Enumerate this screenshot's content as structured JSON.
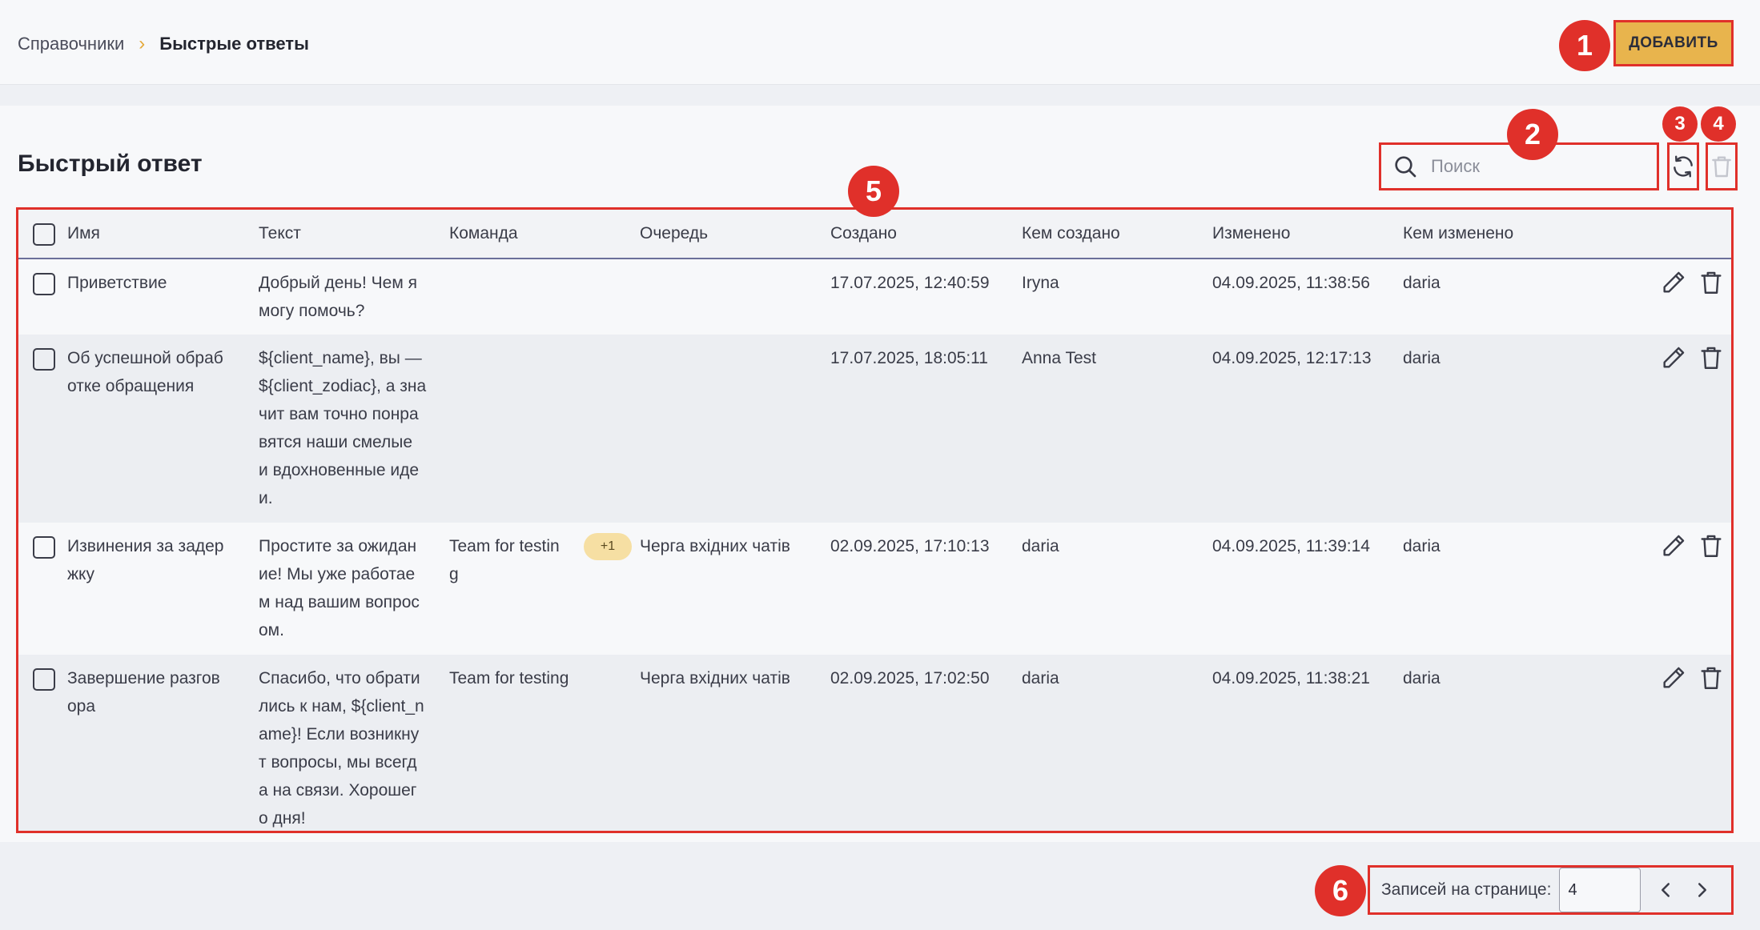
{
  "breadcrumb": {
    "parent": "Справочники",
    "separator": "›",
    "current": "Быстрые ответы"
  },
  "toolbar": {
    "add_label": "ДОБАВИТЬ"
  },
  "card": {
    "title": "Быстрый ответ",
    "search_placeholder": "Поиск"
  },
  "table": {
    "headers": {
      "name": "Имя",
      "text": "Текст",
      "team": "Команда",
      "queue": "Очередь",
      "created": "Создано",
      "created_by": "Кем создано",
      "modified": "Изменено",
      "modified_by": "Кем изменено"
    },
    "rows": [
      {
        "name": [
          "Приветствие"
        ],
        "text": [
          "Добрый день! Чем я",
          "могу помочь?"
        ],
        "team": [],
        "team_extra": "",
        "queue": "",
        "created": "17.07.2025, 12:40:59",
        "created_by": "Iryna",
        "modified": "04.09.2025, 11:38:56",
        "modified_by": "daria"
      },
      {
        "name": [
          "Об успешной обраб",
          "отке обращения"
        ],
        "text": [
          "${client_name}, вы —",
          "${client_zodiac}, а зна",
          "чит вам точно понра",
          "вятся наши смелые",
          "и вдохновенные иде",
          "и."
        ],
        "team": [],
        "team_extra": "",
        "queue": "",
        "created": "17.07.2025, 18:05:11",
        "created_by": "Anna Test",
        "modified": "04.09.2025, 12:17:13",
        "modified_by": "daria"
      },
      {
        "name": [
          "Извинения за задер",
          "жку"
        ],
        "text": [
          "Простите за ожидан",
          "ие! Мы уже работае",
          "м над вашим вопрос",
          "ом."
        ],
        "team": [
          "Team for testin",
          "g"
        ],
        "team_extra": "+1",
        "queue": "Черга вхідних чатів",
        "created": "02.09.2025, 17:10:13",
        "created_by": "daria",
        "modified": "04.09.2025, 11:39:14",
        "modified_by": "daria"
      },
      {
        "name": [
          "Завершение разгов",
          "ора"
        ],
        "text": [
          "Спасибо, что обрати",
          "лись к нам, ${client_n",
          "ame}! Если возникну",
          "т вопросы, мы всегд",
          "а на связи. Хорошег",
          "о дня!"
        ],
        "team": [
          "Team for testing"
        ],
        "team_extra": "",
        "queue": "Черга вхідних чатів",
        "created": "02.09.2025, 17:02:50",
        "created_by": "daria",
        "modified": "04.09.2025, 11:38:21",
        "modified_by": "daria"
      }
    ]
  },
  "pagination": {
    "label": "Записей на странице:",
    "page_size": "4"
  },
  "markers": [
    "1",
    "2",
    "3",
    "4",
    "5",
    "6"
  ],
  "colors": {
    "accent": "#e8b44d",
    "highlight": "#e0302a",
    "chip": "#f6dfa3",
    "text": "#3a3c48"
  },
  "icons": {
    "search": "search-icon",
    "refresh": "refresh-icon",
    "delete": "trash-icon",
    "edit": "pencil-icon",
    "prev": "chevron-left-icon",
    "next": "chevron-right-icon"
  }
}
